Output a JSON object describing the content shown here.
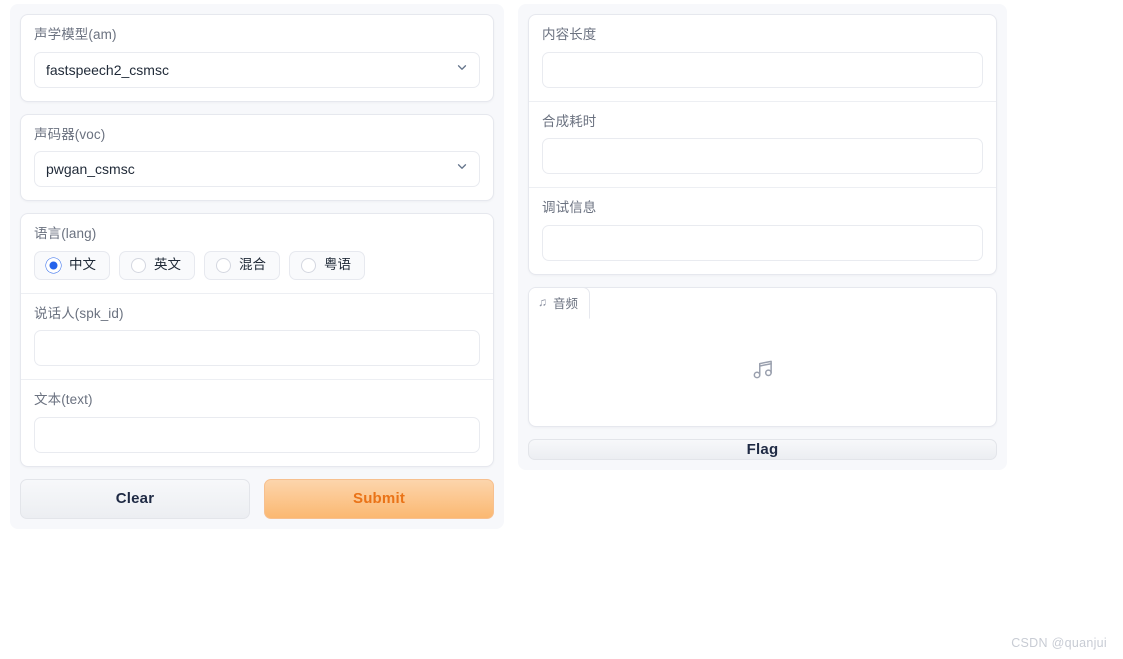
{
  "left": {
    "am": {
      "label": "声学模型(am)",
      "value": "fastspeech2_csmsc",
      "icon": "chevron-down-icon"
    },
    "voc": {
      "label": "声码器(voc)",
      "value": "pwgan_csmsc",
      "icon": "chevron-down-icon"
    },
    "lang": {
      "label": "语言(lang)",
      "options": [
        {
          "label": "中文",
          "selected": true
        },
        {
          "label": "英文",
          "selected": false
        },
        {
          "label": "混合",
          "selected": false
        },
        {
          "label": "粤语",
          "selected": false
        }
      ]
    },
    "spk_id": {
      "label": "说话人(spk_id)",
      "value": "",
      "placeholder": ""
    },
    "text": {
      "label": "文本(text)",
      "value": "",
      "placeholder": ""
    },
    "buttons": {
      "clear": "Clear",
      "submit": "Submit"
    }
  },
  "right": {
    "content_length": {
      "label": "内容长度",
      "value": "",
      "placeholder": ""
    },
    "synth_time": {
      "label": "合成耗时",
      "value": "",
      "placeholder": ""
    },
    "debug_info": {
      "label": "调试信息",
      "value": "",
      "placeholder": ""
    },
    "audio": {
      "tab_label": "音频",
      "tab_icon": "music-note-icon",
      "placeholder_icon": "music-note-icon"
    },
    "flag_button": "Flag"
  },
  "watermark": "CSDN @quanjui",
  "colors": {
    "page_background": "#ffffff",
    "column_background": "#f7f8fb",
    "panel_background": "#ffffff",
    "border": "#e6e8ee",
    "label_text": "#6b7280",
    "value_text": "#1f2937",
    "radio_selected": "#2563eb",
    "submit_text": "#ea7317",
    "submit_gradient_start": "#fcd5ac",
    "submit_gradient_end": "#fbb871",
    "watermark_text": "#c8ccd4"
  }
}
